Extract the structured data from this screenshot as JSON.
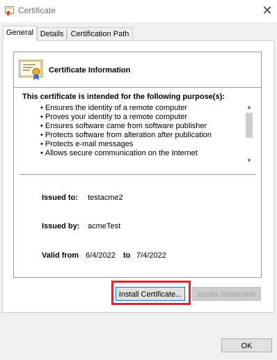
{
  "window": {
    "title": "Certificate",
    "close_glyph": "✕"
  },
  "tabs": [
    {
      "label": "General",
      "active": true
    },
    {
      "label": "Details",
      "active": false
    },
    {
      "label": "Certification Path",
      "active": false
    }
  ],
  "info": {
    "heading": "Certificate Information",
    "purpose_heading": "This certificate is intended for the following purpose(s):",
    "purposes": [
      "Ensures the identity of a remote computer",
      "Proves your identity to a remote computer",
      "Ensures software came from software publisher",
      "Protects software from alteration after publication",
      "Protects e-mail messages",
      "Allows secure communication on the Internet"
    ],
    "issued_to_label": "Issued to:",
    "issued_to_value": "testacme2",
    "issued_by_label": "Issued by:",
    "issued_by_value": "acmeTest",
    "valid_from_label": "Valid from",
    "valid_from_value": "6/4/2022",
    "valid_to_label": "to",
    "valid_to_value": "7/4/2022"
  },
  "buttons": {
    "install": "Install Certificate...",
    "issuer": "Issuer Statement",
    "ok": "OK"
  },
  "icons": {
    "title": "certificate-icon",
    "info": "certificate-icon",
    "scroll_up": "chevron-up-icon",
    "scroll_down": "chevron-down-icon"
  },
  "colors": {
    "highlight": "#e8222b",
    "focus": "#0078d7"
  }
}
